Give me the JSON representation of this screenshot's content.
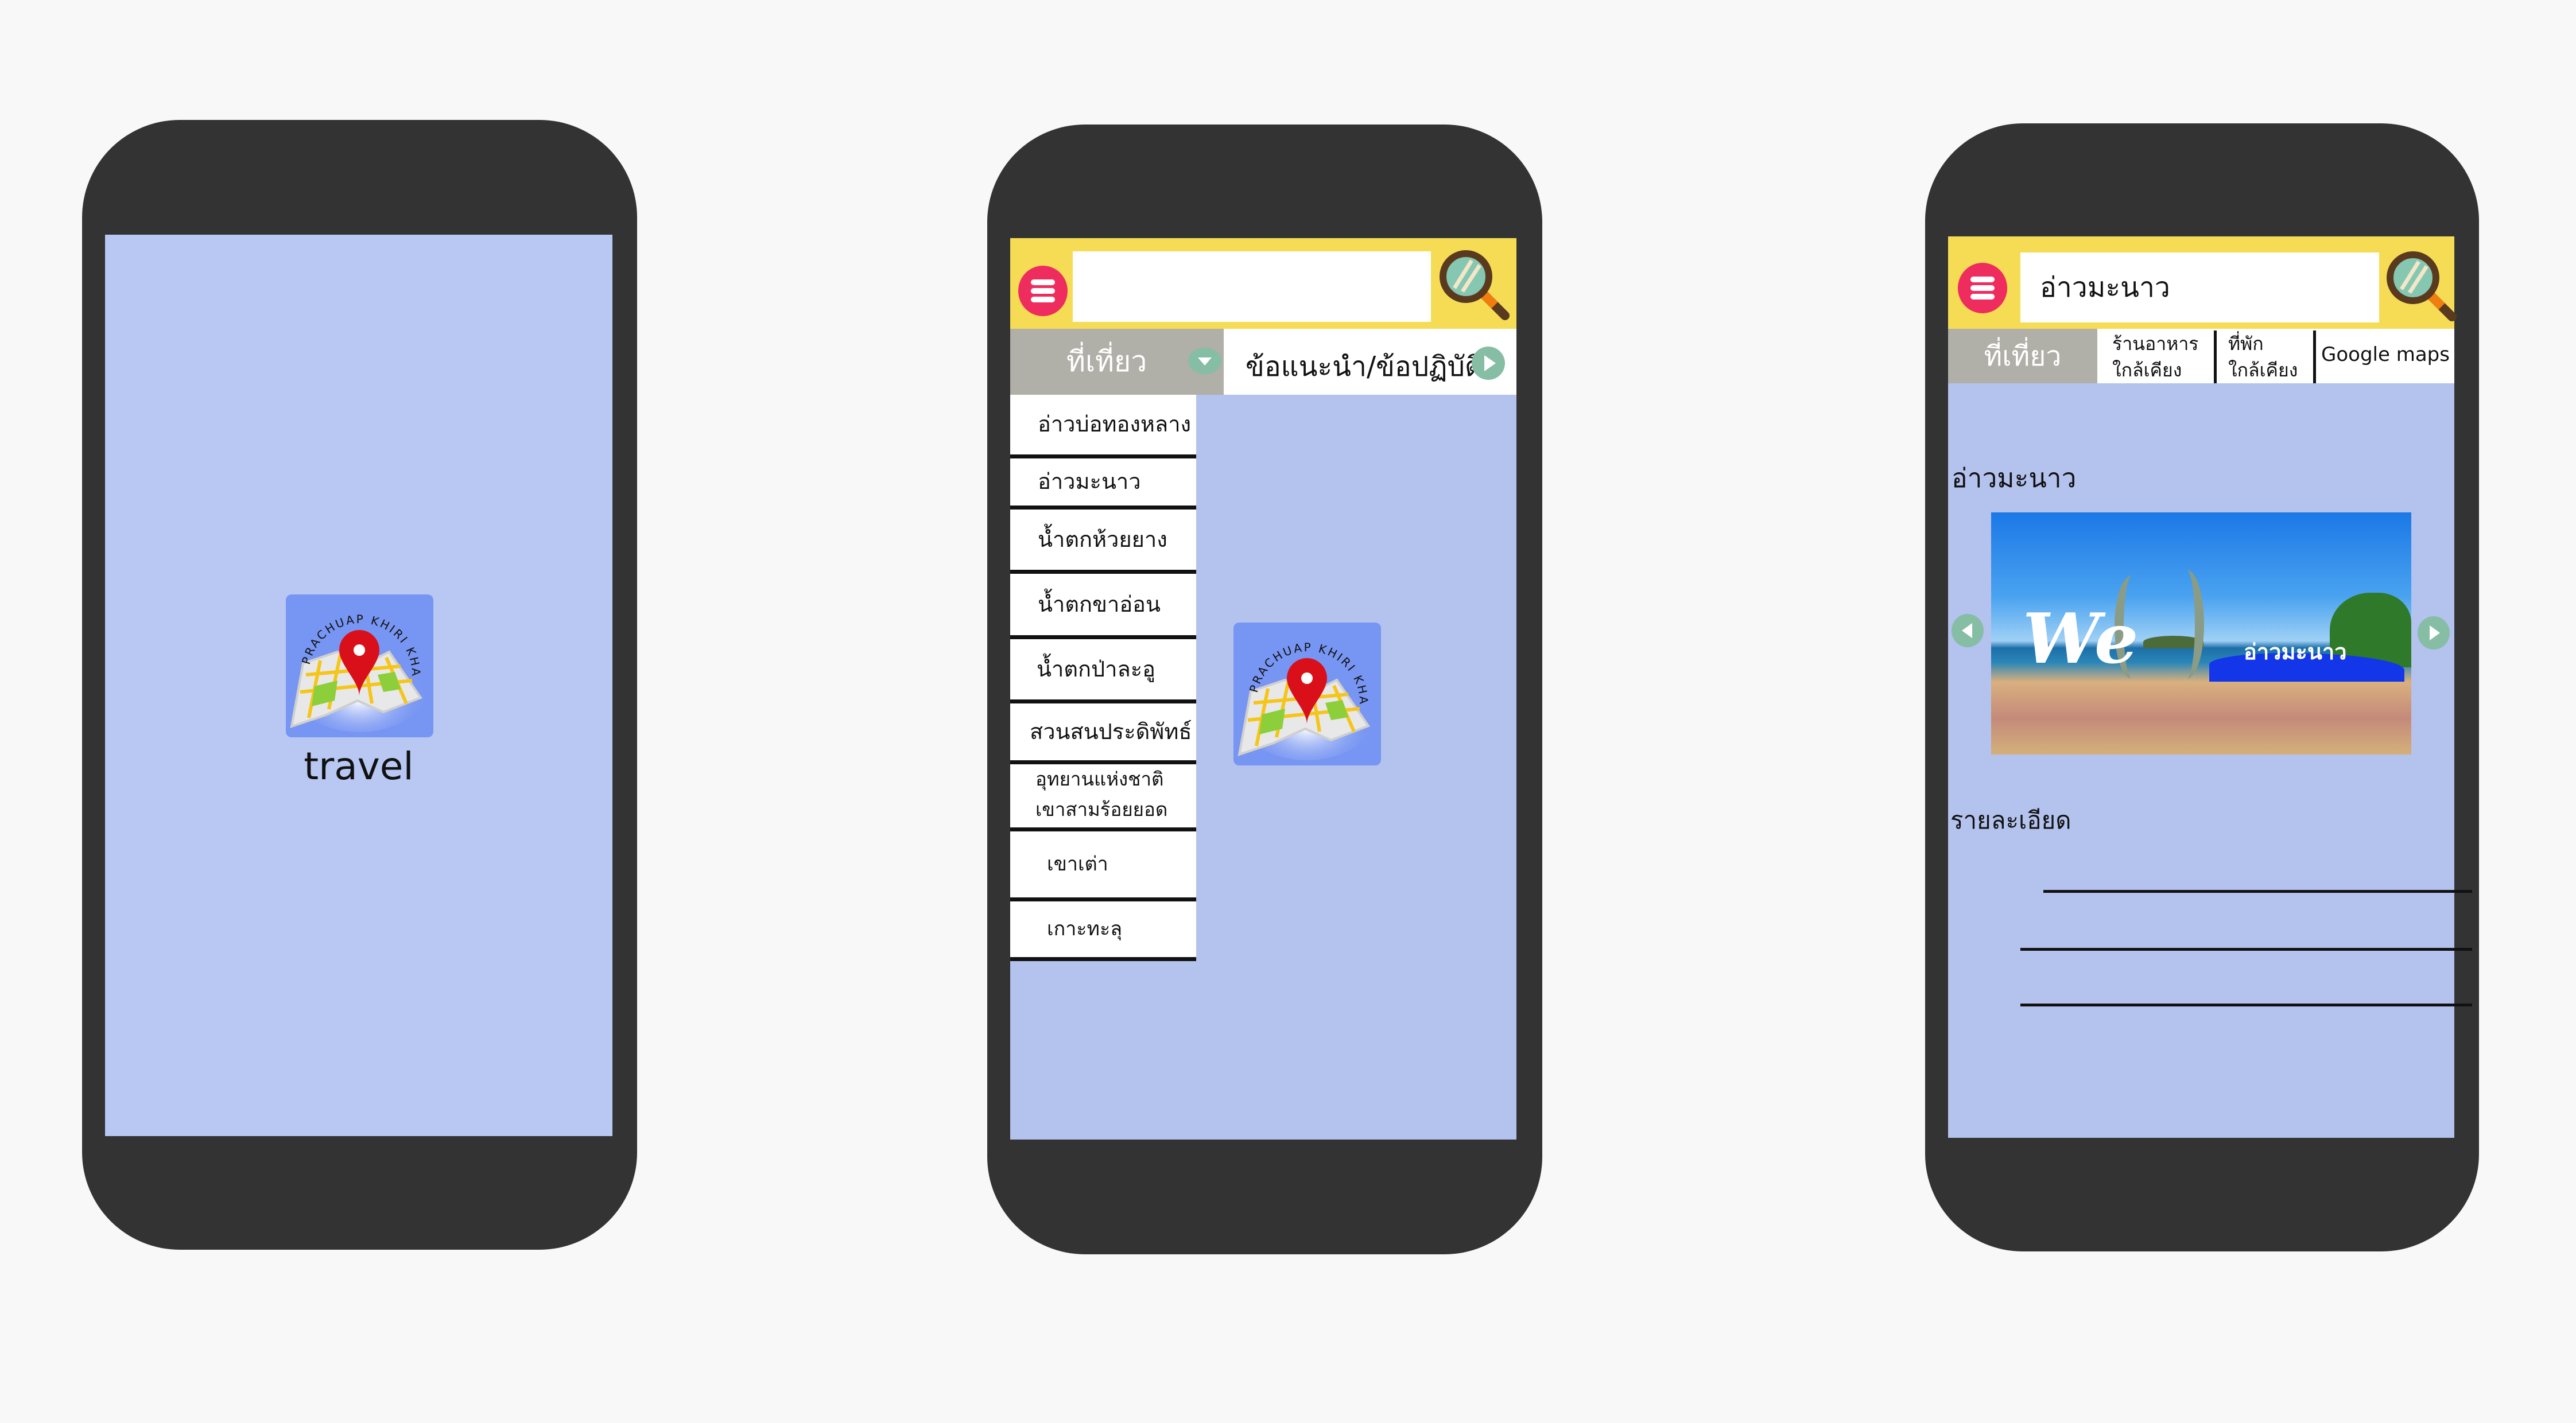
{
  "colors": {
    "background": "#f8f8f8",
    "phone_body": "#333333",
    "screen": "#b4c2ee",
    "header_yellow": "#f6dc55",
    "tab_gray": "#b0afa8",
    "menu_button": "#ee2d5e",
    "arrow_button": "#86bda5"
  },
  "logo": {
    "icon": "map-pin-logo-icon",
    "lettering": "PRACHUAP KHIRI KHAN"
  },
  "splash": {
    "app_name": "travel"
  },
  "menu_screen": {
    "search": {
      "value": "",
      "placeholder": ""
    },
    "tabs": [
      {
        "label": "ที่เที่ยว",
        "icon": "chevron-down-icon"
      },
      {
        "label": "ข้อแนะนำ/ข้อปฏิบัติ",
        "icon": "play-right-icon"
      }
    ],
    "places": [
      "อ่าวบ่อทองหลาง",
      "อ่าวมะนาว",
      "น้ำตกห้วยยาง",
      "น้ำตกขาอ่อน",
      "น้ำตกป่าละอู",
      "สวนสนประดิพัทธ์",
      "อุทยานแห่งชาติ เขาสามร้อยยอด",
      "เขาเต่า",
      "เกาะทะลุ"
    ],
    "places_multiline": [
      "อุทยานแห่งชาติ",
      "เขาสามร้อยยอด"
    ]
  },
  "detail_screen": {
    "search": {
      "value": "อ่าวมะนาว"
    },
    "tabs": [
      {
        "label": "ที่เที่ยว"
      },
      {
        "label_line1": "ร้านอาหาร",
        "label_line2": "ใกล้เคียง"
      },
      {
        "label_line1": "ที่พัก",
        "label_line2": "ใกล้เคียง"
      },
      {
        "label": "Google maps"
      }
    ],
    "title": "อ่าวมะนาว",
    "photo": {
      "lettering_left": "We",
      "lettering_right": "อ่าวมะนาว"
    },
    "details_label": "รายละเอียด"
  }
}
